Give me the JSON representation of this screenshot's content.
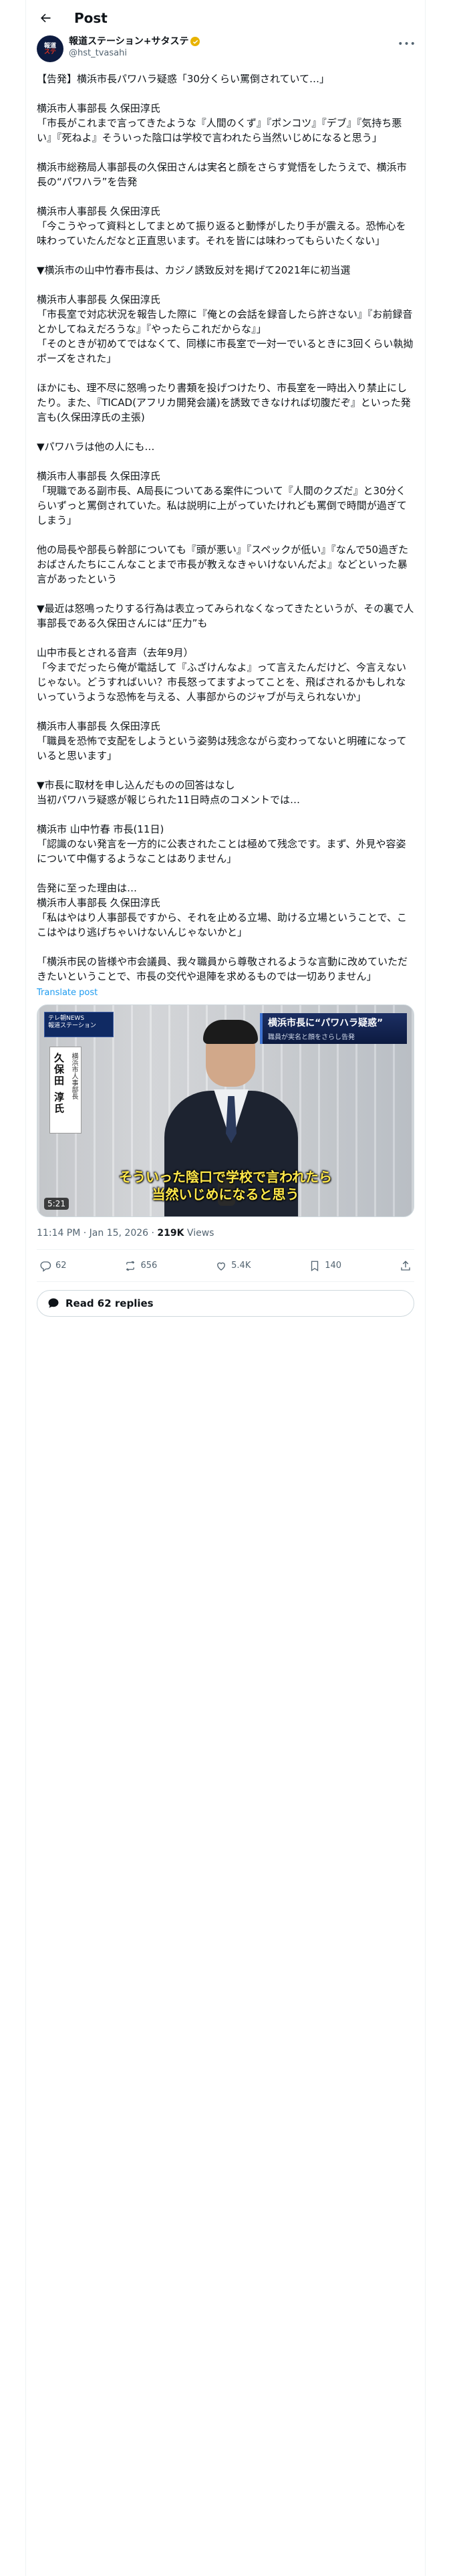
{
  "header": {
    "title": "Post"
  },
  "author": {
    "display_name": "報道ステーション+サタステ",
    "handle": "@hst_tvasahi",
    "avatar_text_top": "報道",
    "avatar_text_bottom": "ステ",
    "badge_color": "#e8b300"
  },
  "tweet": {
    "text": "【告発】横浜市長パワハラ疑惑「30分くらい罵倒されていて…」\n\n横浜市人事部長 久保田淳氏\n「市長がこれまで言ってきたような『人間のくず』『ポンコツ』『デブ』『気持ち悪い』『死ねよ』そういった陰口は学校で言われたら当然いじめになると思う」\n\n横浜市総務局人事部長の久保田さんは実名と顔をさらす覚悟をしたうえで、横浜市長の“パワハラ”を告発\n\n横浜市人事部長 久保田淳氏\n「今こうやって資料としてまとめて振り返ると動悸がしたり手が震える。恐怖心を味わっていたんだなと正直思います。それを皆には味わってもらいたくない」\n\n▼横浜市の山中竹春市長は、カジノ誘致反対を掲げて2021年に初当選\n\n横浜市人事部長 久保田淳氏\n「市長室で対応状況を報告した際に『俺との会話を録音したら許さない』『お前録音とかしてねえだろうな』『やったらこれだからな』」\n「そのときが初めてではなくて、同様に市長室で一対一でいるときに3回くらい執拗ポーズをされた」\n\nほかにも、理不尽に怒鳴ったり書類を投げつけたり、市長室を一時出入り禁止にしたり。また、『TICAD(アフリカ開発会議)を誘致できなければ切腹だぞ』といった発言も(久保田淳氏の主張)\n\n▼パワハラは他の人にも…\n\n横浜市人事部長 久保田淳氏\n「現職である副市長、A局長についてある案件について『人間のクズだ』と30分くらいずっと罵倒されていた。私は説明に上がっていたけれども罵倒で時間が過ぎてしまう」\n\n他の局長や部長ら幹部についても『頭が悪い』『スペックが低い』『なんで50過ぎたおばさんたちにこんなことまで市長が教えなきゃいけないんだよ』などといった暴言があったという\n\n▼最近は怒鳴ったりする行為は表立ってみられなくなってきたというが、その裏で人事部長である久保田さんには“圧力”も\n\n山中市長とされる音声（去年9月）\n「今までだったら俺が電話して『ふざけんなよ』って言えたんだけど、今言えないじゃない。どうすればいい？市長怒ってますよってことを、飛ばされるかもしれないっていうような恐怖を与える、人事部からのジャブが与えられないか」\n\n横浜市人事部長 久保田淳氏\n「職員を恐怖で支配をしようという姿勢は残念ながら変わってないと明確になっていると思います」\n\n▼市長に取材を申し込んだものの回答はなし\n当初パワハラ疑惑が報じられた11日時点のコメントでは…\n\n横浜市 山中竹春 市長(11日)\n「認識のない発言を一方的に公表されたことは極めて残念です。まず、外見や容姿について中傷するようなことはありません」\n\n告発に至った理由は…\n横浜市人事部長 久保田淳氏\n「私はやはり人事部長ですから、それを止める立場、助ける立場ということで、ここはやはり逃げちゃいけないんじゃないかと」\n\n「横浜市民の皆様や市会議員、我々職員から尊敬されるような言動に改めていただきたいということで、市長の交代や退陣を求めるものでは一切ありません」",
    "translate_label": "Translate post"
  },
  "media": {
    "logo_line1": "テレ朝NEWS",
    "logo_line2": "報道ステーション",
    "headline_main": "横浜市長に“パワハラ疑惑”",
    "headline_sub": "職員が実名と顔をさらし告発",
    "nameplate_title": "横浜市人事部長",
    "nameplate_name": "久保田 淳氏",
    "caption": "そういった陰口で学校で言われたら\n当然いじめになると思う",
    "duration": "5:21"
  },
  "meta": {
    "time": "11:14 PM · Jan 15, 2026 · ",
    "views_count": "219K",
    "views_label": " Views"
  },
  "actions": {
    "replies": "62",
    "reposts": "656",
    "likes": "5.4K",
    "bookmarks": "140"
  },
  "read_replies_label": "Read 62 replies"
}
